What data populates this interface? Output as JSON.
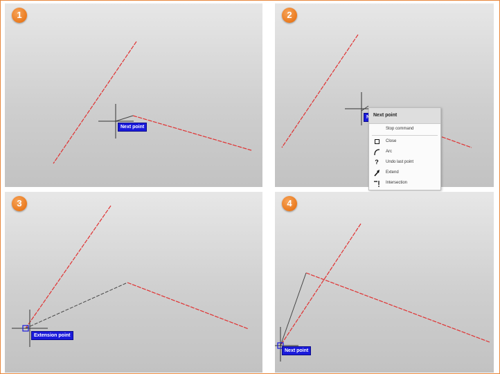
{
  "steps": [
    {
      "number": "1",
      "tooltip": "Next point"
    },
    {
      "number": "2",
      "tooltip": "Ne"
    },
    {
      "number": "3",
      "tooltip": "Extension point"
    },
    {
      "number": "4",
      "tooltip": "Next point"
    }
  ],
  "context_menu": {
    "title": "Next point",
    "items": [
      {
        "label": "Stop command",
        "icon": "none"
      },
      {
        "label": "Close",
        "icon": "square-icon"
      },
      {
        "label": "Arc",
        "icon": "arc-icon"
      },
      {
        "label": "Undo last point",
        "icon": "undo-icon"
      },
      {
        "label": "Extend",
        "icon": "extend-icon"
      },
      {
        "label": "Intersection",
        "icon": "intersection-icon"
      }
    ]
  },
  "colors": {
    "frame_border": "#e8863a",
    "badge": "#ea7a1e",
    "red_line": "#e03030",
    "tooltip_bg": "#1a1adb"
  }
}
